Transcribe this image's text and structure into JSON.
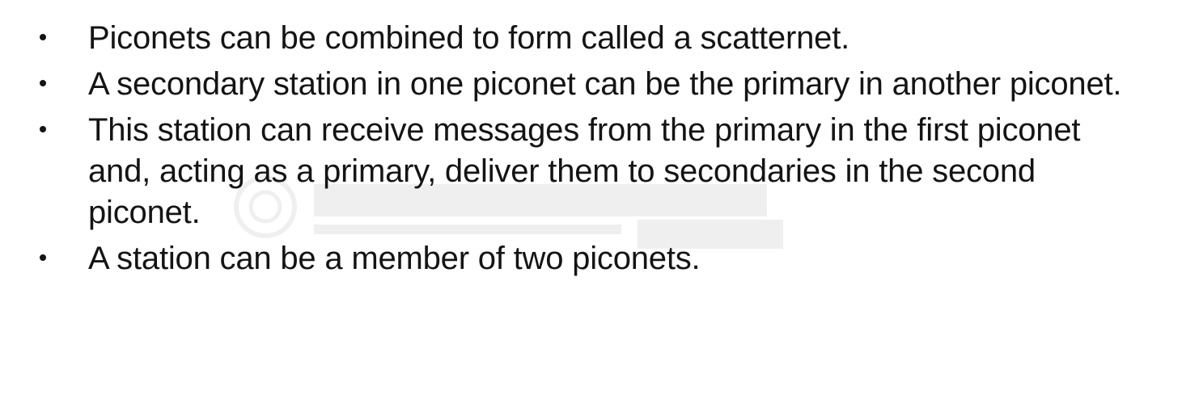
{
  "slide": {
    "bullets": [
      {
        "text": "Piconets can be combined to form called a scatternet."
      },
      {
        "text": "A secondary station in one piconet can be the primary in another piconet."
      },
      {
        "text": "This station can receive messages from the primary in the first piconet and, acting as a primary, deliver them to secondaries in the second piconet."
      },
      {
        "text": "A station can be a member of two piconets."
      }
    ]
  },
  "watermark": {
    "logo_icon": "institution-seal-icon"
  },
  "colors": {
    "background": "#ffffff",
    "text": "#141414",
    "watermark": "#000000"
  }
}
